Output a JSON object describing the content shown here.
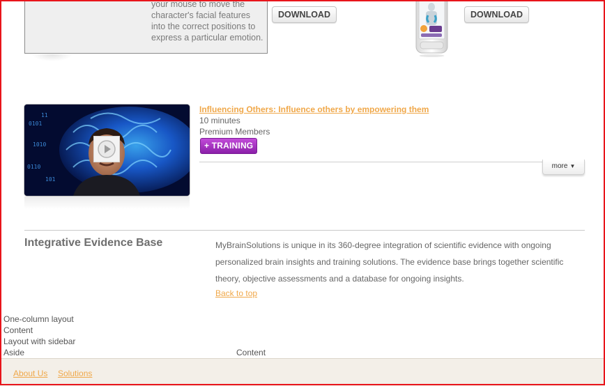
{
  "top_row": {
    "game_description": "your mouse to move the character's facial features into the correct positions to express a particular emotion.",
    "download_label_1": "DOWNLOAD",
    "download_label_2": "DOWNLOAD"
  },
  "video": {
    "title": "Influencing Others: Influence others by empowering them",
    "duration": "10 minutes",
    "audience": "Premium Members",
    "training_label": "+ TRAINING",
    "more_label": "more"
  },
  "evidence": {
    "heading": "Integrative Evidence Base",
    "body": "MyBrainSolutions is unique in its 360-degree integration of scientific evidence with ongoing personalized brain insights and training solutions. The evidence base brings together scientific theory, objective assessments and a database for ongoing insights.",
    "back_to_top": "Back to top"
  },
  "layout_text": {
    "one_column": "One-column layout",
    "content_1": "Content",
    "with_sidebar": "Layout with sidebar",
    "aside": "Aside",
    "content_2": "Content"
  },
  "footer": {
    "links": [
      "About Us",
      "Solutions"
    ]
  },
  "colors": {
    "link": "#f0a84a",
    "training_button": "#9b2cbd",
    "frame_border": "#e8141b",
    "footer_bg": "#f3efe8"
  }
}
